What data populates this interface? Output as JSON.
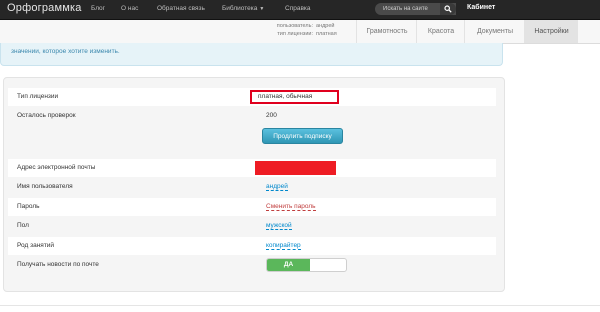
{
  "topbar": {
    "brand": "Орфограммка",
    "nav": [
      {
        "label": "Блог"
      },
      {
        "label": "О нас"
      },
      {
        "label": "Обратная связь"
      },
      {
        "label": "Библиотека"
      },
      {
        "label": "Справка"
      }
    ],
    "search_placeholder": "Искать на сайте",
    "cabinet": "Кабинет"
  },
  "subbar": {
    "user_key": "пользователь:",
    "user_val": "андрей",
    "license_key": "тип лицензии:",
    "license_val": "платная",
    "tabs": [
      {
        "label": "Грамотность"
      },
      {
        "label": "Красота"
      },
      {
        "label": "Документы"
      },
      {
        "label": "Настройки",
        "active": true
      }
    ]
  },
  "alert": {
    "text": "значении, которое хотите изменить."
  },
  "settings": {
    "license_type_label": "Тип лицензии",
    "license_type_value": "платная, обычная",
    "checks_left_label": "Осталось проверок",
    "checks_left_value": "200",
    "renew_button": "Продлить подписку",
    "email_label": "Адрес электронной почты",
    "username_label": "Имя пользователя",
    "username_value": "андрей",
    "password_label": "Пароль",
    "password_value": "Сменить пароль",
    "gender_label": "Пол",
    "gender_value": "мужской",
    "occupation_label": "Род занятий",
    "occupation_value": "копирайтер",
    "newsletter_label": "Получать новости по почте",
    "newsletter_value": "ДА",
    "newsletter_on": true
  },
  "colors": {
    "topbar": "#262626",
    "alert_bg": "#e6f3f8",
    "link": "#0088cc",
    "highlight_border": "#e0001e",
    "toggle_on": "#5bb75b",
    "button": "#2f96b4"
  }
}
